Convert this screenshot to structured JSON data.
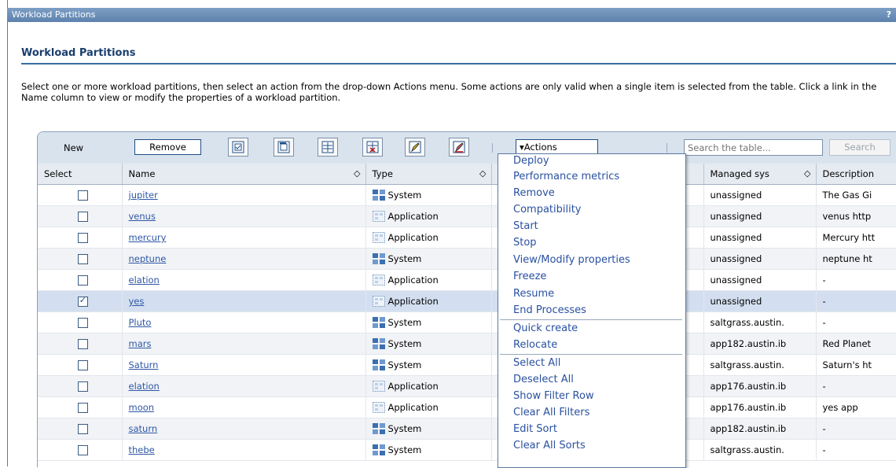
{
  "window": {
    "title": "Workload Partitions",
    "help": "?"
  },
  "page": {
    "heading": "Workload Partitions",
    "intro": "Select one or more workload partitions, then select an action from the drop-down Actions menu. Some actions are only valid when a single item is selected from the table. Click a link in the Name column to view or modify the properties of a workload partition."
  },
  "toolbar": {
    "new_label": "New",
    "remove_label": "Remove",
    "icons": [
      "select-all-icon",
      "deselect-all-icon",
      "show-filter-row-icon",
      "clear-filters-icon",
      "edit-sort-icon",
      "clear-sorts-icon"
    ],
    "actions_label": "▾Actions",
    "search_placeholder": "Search the table...",
    "search_label": "Search"
  },
  "table": {
    "columns": [
      "Select",
      "Name",
      "Type",
      "",
      "Managed sys",
      "Description"
    ],
    "rows": [
      {
        "checked": false,
        "name": "jupiter",
        "type": "System",
        "managed": "unassigned",
        "description": "The Gas Gi"
      },
      {
        "checked": false,
        "name": "venus",
        "type": "Application",
        "managed": "unassigned",
        "description": "venus http"
      },
      {
        "checked": false,
        "name": "mercury",
        "type": "Application",
        "managed": "unassigned",
        "description": "Mercury htt"
      },
      {
        "checked": false,
        "name": "neptune",
        "type": "System",
        "managed": "unassigned",
        "description": "neptune ht"
      },
      {
        "checked": false,
        "name": "elation",
        "type": "Application",
        "managed": "unassigned",
        "description": "-"
      },
      {
        "checked": true,
        "name": "yes",
        "type": "Application",
        "managed": "unassigned",
        "description": "-"
      },
      {
        "checked": false,
        "name": "Pluto",
        "type": "System",
        "managed": "saltgrass.austin.",
        "description": "-"
      },
      {
        "checked": false,
        "name": "mars",
        "type": "System",
        "managed": "app182.austin.ib",
        "description": "Red Planet"
      },
      {
        "checked": false,
        "name": "Saturn",
        "type": "System",
        "managed": "saltgrass.austin.",
        "description": "Saturn's ht"
      },
      {
        "checked": false,
        "name": "elation",
        "type": "Application",
        "managed": "app176.austin.ib",
        "description": "-"
      },
      {
        "checked": false,
        "name": "moon",
        "type": "Application",
        "managed": "app176.austin.ib",
        "description": "yes app"
      },
      {
        "checked": false,
        "name": "saturn",
        "type": "System",
        "managed": "app182.austin.ib",
        "description": "-"
      },
      {
        "checked": false,
        "name": "thebe",
        "type": "System",
        "managed": "saltgrass.austin.",
        "description": "-"
      }
    ]
  },
  "actions_menu": {
    "groups": [
      [
        "Deploy",
        "Performance metrics",
        "Remove",
        "Compatibility",
        "Start",
        "Stop",
        "View/Modify properties",
        "Freeze",
        "Resume",
        "End Processes"
      ],
      [
        "Quick create",
        "Relocate"
      ],
      [
        "Select All",
        "Deselect All",
        "Show Filter Row",
        "Clear All Filters",
        "Edit Sort",
        "Clear All Sorts"
      ]
    ]
  },
  "colors": {
    "title_bar": "#6a8fba",
    "heading": "#1a3f6e",
    "link": "#2f57a6",
    "selected_row": "#d3dff0"
  }
}
